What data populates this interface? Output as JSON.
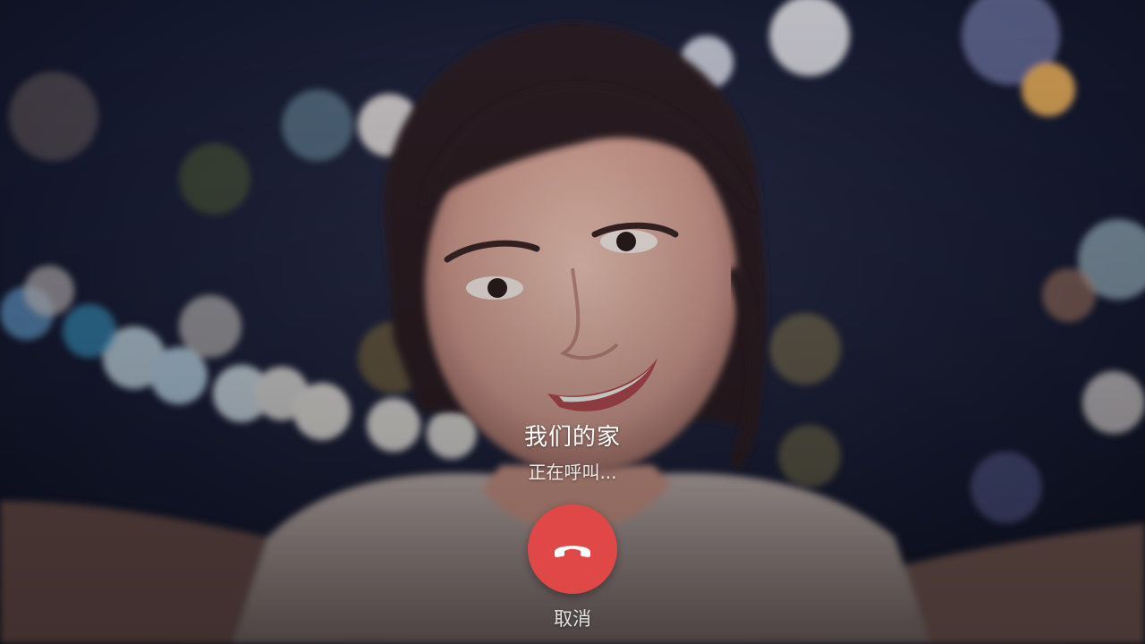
{
  "call": {
    "caller_name": "我们的家",
    "status": "正在呼叫...",
    "cancel_label": "取消"
  },
  "icons": {
    "hangup": "phone-hangup-icon"
  },
  "colors": {
    "hangup_button": "#e04847",
    "text": "#ffffff"
  }
}
